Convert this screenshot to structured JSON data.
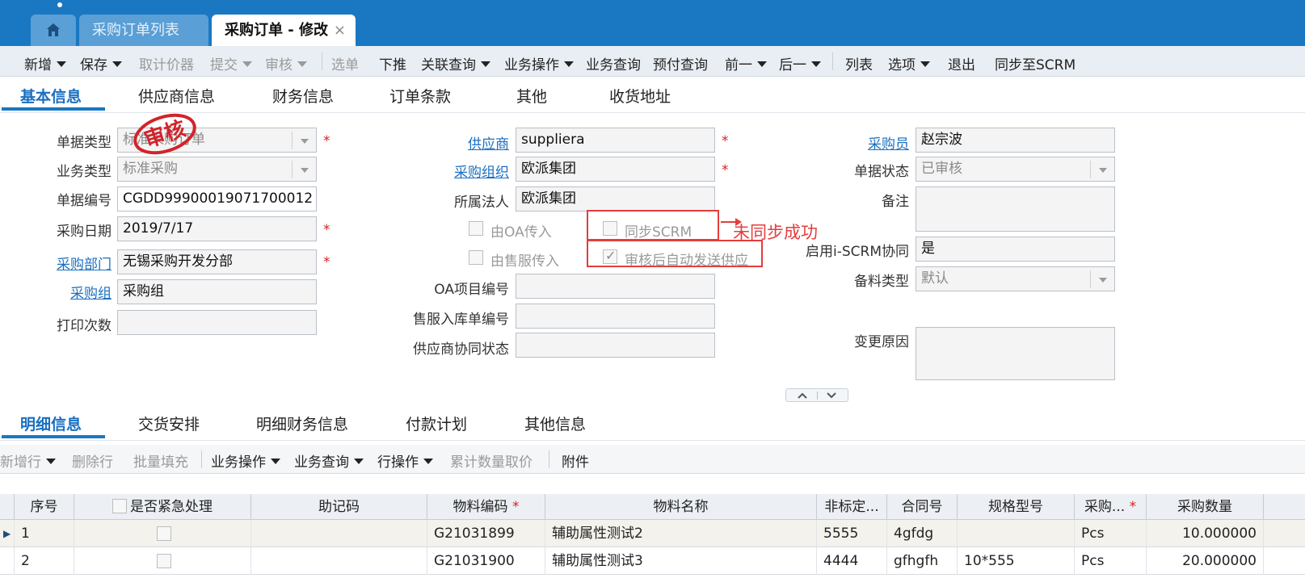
{
  "tabs": {
    "home_icon": "home-icon",
    "list_tab": "采购订单列表",
    "active_tab": "采购订单 - 修改",
    "close": "×"
  },
  "toolbar": {
    "new": "新增",
    "save": "保存",
    "fetch_price": "取计价器",
    "submit": "提交",
    "audit": "审核",
    "select_bill": "选单",
    "push_down": "下推",
    "related_query": "关联查询",
    "biz_ops": "业务操作",
    "biz_query": "业务查询",
    "prepay_query": "预付查询",
    "prev": "前一",
    "next": "后一",
    "list": "列表",
    "options": "选项",
    "exit": "退出",
    "sync_scrm": "同步至SCRM"
  },
  "section_tabs": [
    "基本信息",
    "供应商信息",
    "财务信息",
    "订单条款",
    "其他",
    "收货地址"
  ],
  "form": {
    "bill_type_label": "单据类型",
    "bill_type_value": "标准采购订单",
    "biz_type_label": "业务类型",
    "biz_type_value": "标准采购",
    "bill_no_label": "单据编号",
    "bill_no_value": "CGDD99900019071700012",
    "date_label": "采购日期",
    "date_value": "2019/7/17",
    "dept_label": "采购部门",
    "dept_value": "无锡采购开发分部",
    "group_label": "采购组",
    "group_value": "采购组",
    "print_label": "打印次数",
    "print_value": "",
    "supplier_label": "供应商",
    "supplier_value": "suppliera",
    "org_label": "采购组织",
    "org_value": "欧派集团",
    "legal_label": "所属法人",
    "legal_value": "欧派集团",
    "oa_in_label": "由OA传入",
    "sync_scrm_label": "同步SCRM",
    "after_sale_label": "由售服传入",
    "auto_send_label": "审核后自动发送供应",
    "oa_project_label": "OA项目编号",
    "oa_project_value": "",
    "after_sale_no_label": "售服入库单编号",
    "after_sale_no_value": "",
    "supplier_collab_label": "供应商协同状态",
    "supplier_collab_value": "",
    "buyer_label": "采购员",
    "buyer_value": "赵宗波",
    "status_label": "单据状态",
    "status_value": "已审核",
    "remark_label": "备注",
    "remark_value": "",
    "iscrm_label": "启用i-SCRM协同",
    "iscrm_value": "是",
    "stock_type_label": "备料类型",
    "stock_type_value": "默认",
    "change_reason_label": "变更原因",
    "change_reason_value": "",
    "required_mark": "*",
    "stamp_text": "审核",
    "annotation": "未同步成功"
  },
  "detail_tabs": [
    "明细信息",
    "交货安排",
    "明细财务信息",
    "付款计划",
    "其他信息"
  ],
  "detail_toolbar": {
    "add_row": "新增行",
    "delete_row": "删除行",
    "batch_fill": "批量填充",
    "biz_ops": "业务操作",
    "biz_query": "业务查询",
    "row_ops": "行操作",
    "cumulative_price": "累计数量取价",
    "attachment": "附件"
  },
  "grid": {
    "headers": [
      "序号",
      "是否紧急处理",
      "助记码",
      "物料编码",
      "物料名称",
      "非标定...",
      "合同号",
      "规格型号",
      "采购...",
      "采购数量"
    ],
    "rows": [
      [
        "1",
        "",
        "",
        "G21031899",
        "辅助属性测试2",
        "5555",
        "4gfdg",
        "",
        "Pcs",
        "10.000000"
      ],
      [
        "2",
        "",
        "",
        "G21031900",
        "辅助属性测试3",
        "4444",
        "gfhgfh",
        "10*555",
        "Pcs",
        "20.000000"
      ]
    ]
  },
  "colors": {
    "topbar": "#1a78c2",
    "accent": "#1a6fc0",
    "required": "#d92020",
    "annotation": "#e43d3d"
  }
}
